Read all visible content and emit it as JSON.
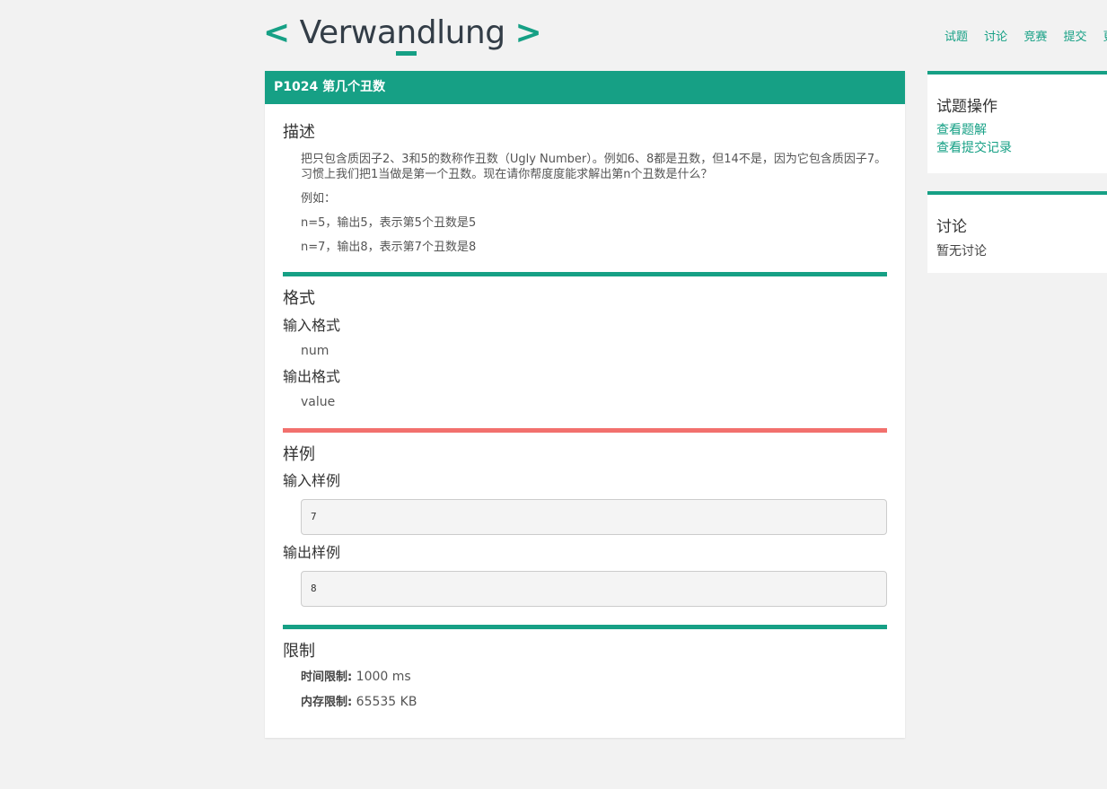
{
  "logo": {
    "left": "<",
    "pre": "Verwa",
    "mid": "n",
    "post": "dlung",
    "right": ">"
  },
  "nav": [
    "试题",
    "讨论",
    "竞赛",
    "提交",
    "更"
  ],
  "problem": {
    "title": "P1024 第几个丑数",
    "description_heading": "描述",
    "description": "把只包含质因子2、3和5的数称作丑数（Ugly Number）。例如6、8都是丑数，但14不是，因为它包含质因子7。 习惯上我们把1当做是第一个丑数。现在请你帮度度能求解出第n个丑数是什么？",
    "example_label": "例如：",
    "example_lines": [
      "n=5，输出5，表示第5个丑数是5",
      "n=7，输出8，表示第7个丑数是8"
    ],
    "format_heading": "格式",
    "input_format_heading": "输入格式",
    "input_format": "num",
    "output_format_heading": "输出格式",
    "output_format": "value",
    "sample_heading": "样例",
    "sample_input_heading": "输入样例",
    "sample_input": "7",
    "sample_output_heading": "输出样例",
    "sample_output": "8",
    "limit_heading": "限制",
    "time_label": "时间限制:",
    "time_value": "1000 ms",
    "memory_label": "内存限制:",
    "memory_value": "65535 KB"
  },
  "sidebar": {
    "ops_title": "试题操作",
    "ops_links": [
      "查看题解",
      "查看提交记录"
    ],
    "discuss_title": "讨论",
    "discuss_empty": "暂无讨论"
  },
  "colors": {
    "accent": "#16a085",
    "warn_bar": "#f2706d"
  }
}
